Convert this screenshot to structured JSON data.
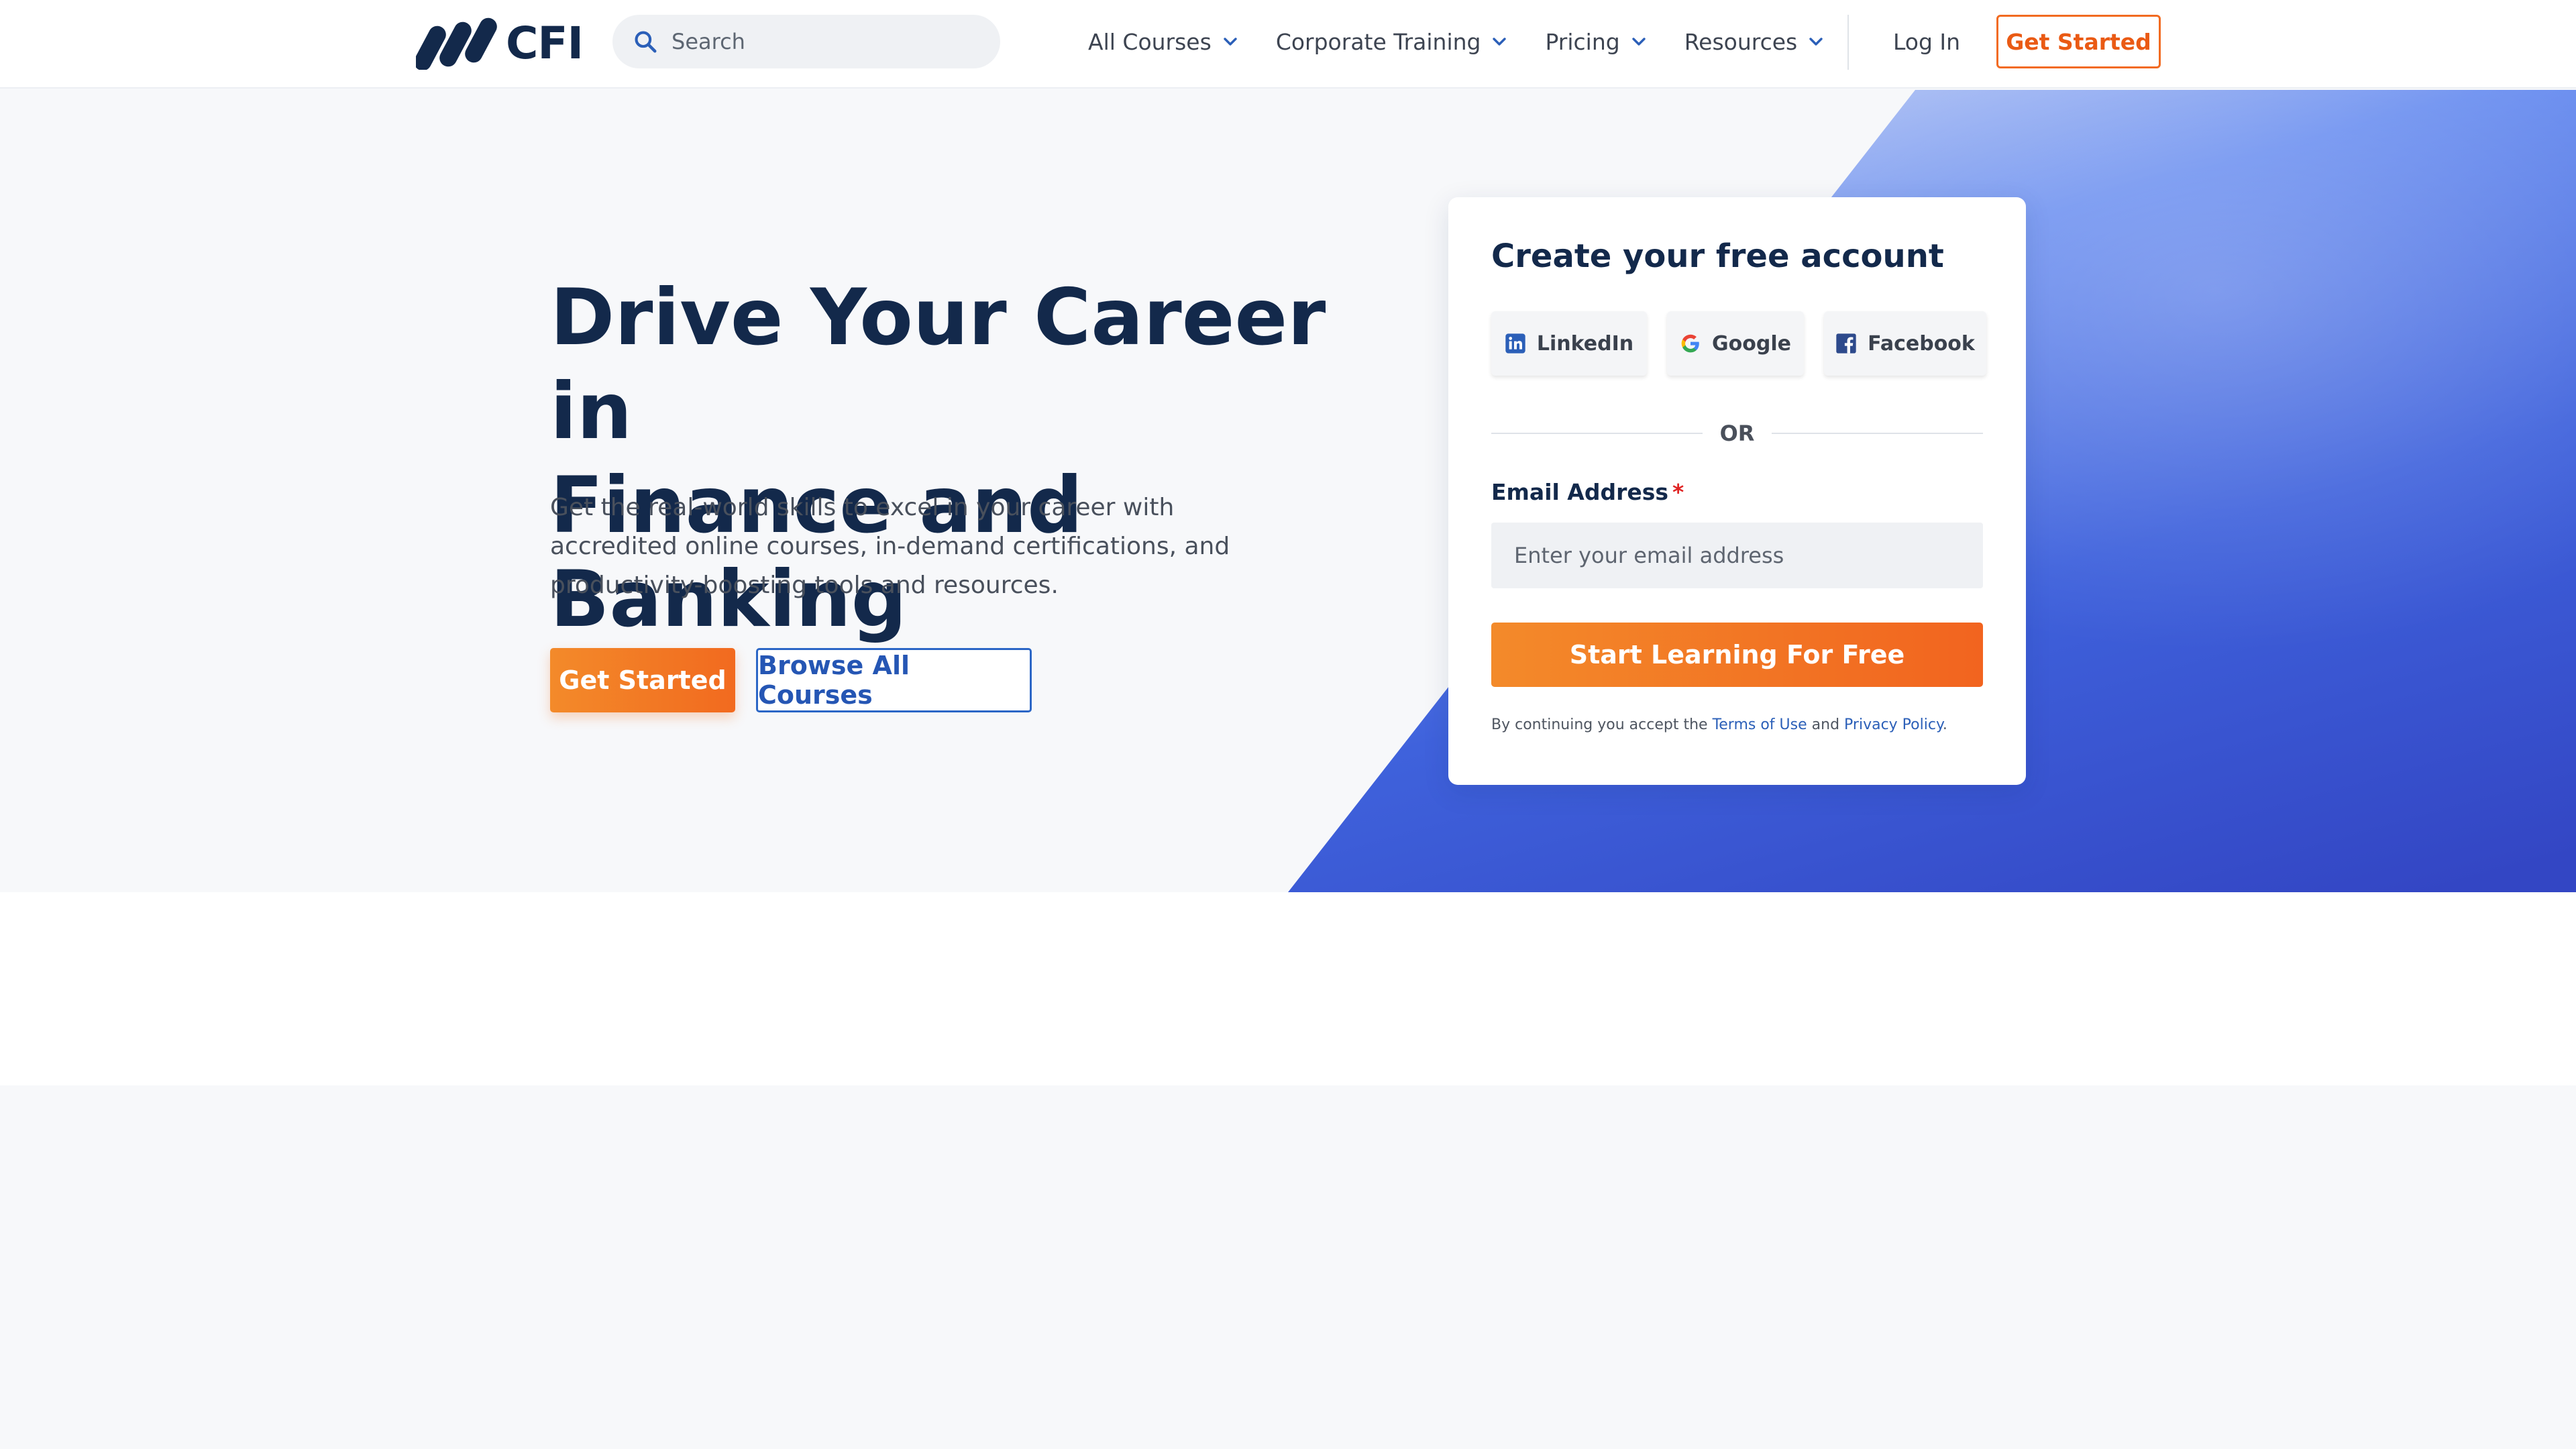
{
  "brand": {
    "name": "CFI"
  },
  "nav": {
    "search_placeholder": "Search",
    "items": [
      {
        "label": "All Courses"
      },
      {
        "label": "Corporate Training"
      },
      {
        "label": "Pricing"
      },
      {
        "label": "Resources"
      }
    ],
    "login_label": "Log In",
    "cta_label": "Get Started"
  },
  "hero": {
    "title_line1": "Drive Your Career in",
    "title_line2": "Finance and Banking",
    "subtitle": "Get the real-world skills to excel in your career with accredited online courses, in-demand certifications, and productivity-boosting tools and resources.",
    "primary_button": "Get Started",
    "secondary_button": "Browse All Courses"
  },
  "signup": {
    "title": "Create your free account",
    "social": [
      {
        "label": "LinkedIn",
        "icon": "linkedin-icon"
      },
      {
        "label": "Google",
        "icon": "google-icon"
      },
      {
        "label": "Facebook",
        "icon": "facebook-icon"
      }
    ],
    "divider_text": "OR",
    "email_label": "Email Address",
    "email_required_mark": "*",
    "email_placeholder": "Enter your email address",
    "submit_label": "Start Learning For Free",
    "terms_prefix": "By continuing you accept the",
    "terms_link": "Terms of Use",
    "terms_and": "and",
    "privacy_link": "Privacy Policy",
    "terms_suffix": "."
  },
  "colors": {
    "navy": "#13294b",
    "orange": "#f26b21",
    "blue": "#2b66c6",
    "hero_gradient_start": "#6b8ef0",
    "hero_gradient_end": "#3346c4"
  }
}
